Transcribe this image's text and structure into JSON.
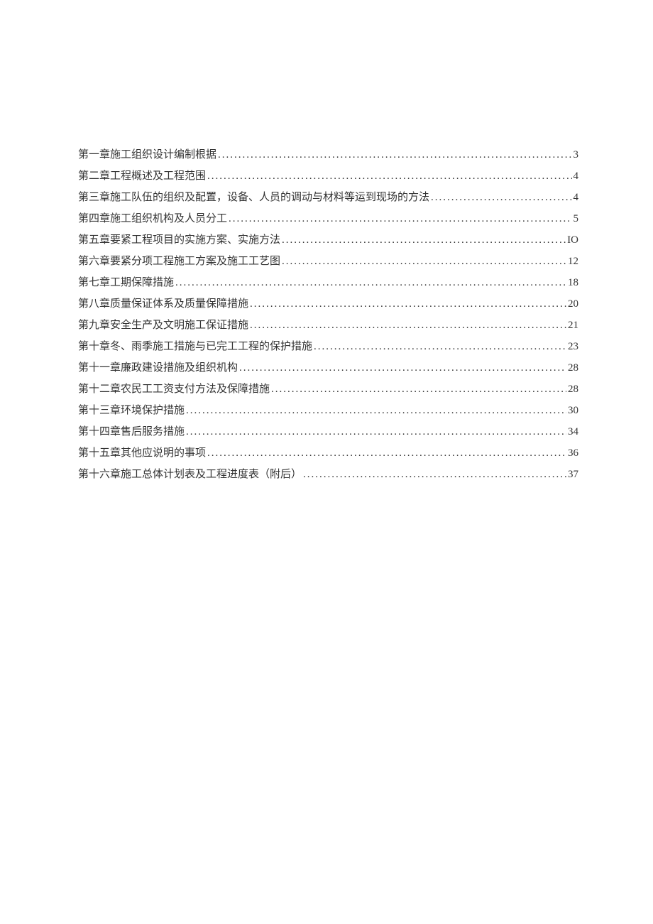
{
  "toc": {
    "entries": [
      {
        "title": "第一章施工组织设计编制根据",
        "page": "3"
      },
      {
        "title": "第二章工程概述及工程范围",
        "page": "4"
      },
      {
        "title": "第三章施工队伍的组织及配置，设备、人员的调动与材料等运到现场的方法",
        "page": "4"
      },
      {
        "title": "第四章施工组织机构及人员分工",
        "page": "5"
      },
      {
        "title": "第五章要紧工程项目的实施方案、实施方法",
        "page": "IO"
      },
      {
        "title": "第六章要紧分项工程施工方案及施工工艺图",
        "page": "12"
      },
      {
        "title": "第七章工期保障措施",
        "page": "18"
      },
      {
        "title": "第八章质量保证体系及质量保障措施",
        "page": "20"
      },
      {
        "title": "第九章安全生产及文明施工保证措施",
        "page": "21"
      },
      {
        "title": "第十章冬、雨季施工措施与已完工工程的保护措施",
        "page": "23"
      },
      {
        "title": "第十一章廉政建设措施及组织机构",
        "page": "28"
      },
      {
        "title": "第十二章农民工工资支付方法及保障措施",
        "page": "28"
      },
      {
        "title": "第十三章环境保护措施",
        "page": "30"
      },
      {
        "title": "第十四章售后服务措施",
        "page": "34"
      },
      {
        "title": "第十五章其他应说明的事项",
        "page": "36"
      },
      {
        "title": "第十六章施工总体计划表及工程进度表（附后）",
        "page": "37"
      }
    ]
  }
}
